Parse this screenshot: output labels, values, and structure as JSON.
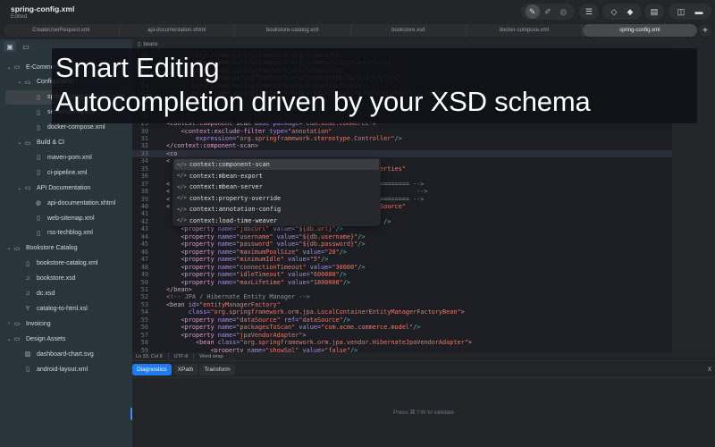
{
  "window": {
    "title": "spring-config.xml",
    "subtitle": "Edited"
  },
  "toolbar": {
    "icons": [
      "pen-icon",
      "signed-pen-icon",
      "globe-icon",
      "format-icon",
      "validate-outline-icon",
      "validate-filled-icon",
      "xsd-doc-icon",
      "sidebar-toggle-icon",
      "bottom-panel-toggle-icon"
    ]
  },
  "tabs": [
    {
      "label": "CreateUserRequest.xml"
    },
    {
      "label": "api-documentation.xhtml"
    },
    {
      "label": "bookstore-catalog.xml"
    },
    {
      "label": "bookstore.xsd"
    },
    {
      "label": "docker-compose.xml"
    },
    {
      "label": "spring-config.xml",
      "active": true
    }
  ],
  "tab_add": "+",
  "sidebar": {
    "items": [
      {
        "label": "E-Commerce",
        "type": "folder",
        "level": 0,
        "chev": "v"
      },
      {
        "label": "Configuration",
        "type": "folder",
        "level": 1,
        "chev": "v"
      },
      {
        "label": "spring-config.xml",
        "type": "file",
        "level": 2,
        "selected": true
      },
      {
        "label": "server-config.xml",
        "type": "file",
        "level": 2
      },
      {
        "label": "docker-compose.xml",
        "type": "file",
        "level": 2
      },
      {
        "label": "Build & CI",
        "type": "folder",
        "level": 1,
        "chev": "v"
      },
      {
        "label": "maven-pom.xml",
        "type": "file",
        "level": 2
      },
      {
        "label": "ci-pipeline.xml",
        "type": "file",
        "level": 2
      },
      {
        "label": "API Documentation",
        "type": "folder",
        "level": 1,
        "chev": "v"
      },
      {
        "label": "api-documentation.xhtml",
        "type": "globe",
        "level": 2
      },
      {
        "label": "web-sitemap.xml",
        "type": "file",
        "level": 2
      },
      {
        "label": "rss-techblog.xml",
        "type": "file",
        "level": 2
      },
      {
        "label": "Bookstore Catalog",
        "type": "folder",
        "level": 0,
        "chev": "v"
      },
      {
        "label": "bookstore-catalog.xml",
        "type": "file",
        "level": 1
      },
      {
        "label": "bookstore.xsd",
        "type": "schema",
        "level": 1
      },
      {
        "label": "dc.xsd",
        "type": "schema",
        "level": 1
      },
      {
        "label": "catalog-to-html.xsl",
        "type": "xsl",
        "level": 1
      },
      {
        "label": "Invoicing",
        "type": "folder",
        "level": 0,
        "chev": ">"
      },
      {
        "label": "Design Assets",
        "type": "folder",
        "level": 0,
        "chev": "v"
      },
      {
        "label": "dashboard-chart.svg",
        "type": "image",
        "level": 1
      },
      {
        "label": "android-layout.xml",
        "type": "file",
        "level": 1
      }
    ]
  },
  "editor": {
    "breadcrumb": "beans",
    "lines": [
      {
        "n": "20",
        "s": [
          [
            "txt",
            "       "
          ],
          [
            "url",
            "http://www.springframework.org/schema/tx"
          ]
        ]
      },
      {
        "n": "21",
        "s": [
          [
            "txt",
            "       "
          ],
          [
            "url",
            "http://www.springframework.org/schema/tx/spring-tx.xsd"
          ]
        ]
      },
      {
        "n": "22",
        "s": [
          [
            "txt",
            "       "
          ],
          [
            "url",
            "http://www.springframework.org/schema/aop"
          ]
        ]
      },
      {
        "n": "23",
        "s": [
          [
            "txt",
            "       "
          ],
          [
            "url",
            "http://www.springframework.org/schema/aop/spring-aop.xsd"
          ]
        ]
      },
      {
        "n": "24",
        "s": [
          [
            "txt",
            "       "
          ],
          [
            "url",
            "http://www.springframework.org/schema/security"
          ]
        ]
      },
      {
        "n": "25",
        "s": [
          [
            "txt",
            "       "
          ],
          [
            "url",
            "http://www.springframework.org/schema/security/spring-security.xsd"
          ],
          [
            "txt",
            "\">"
          ]
        ]
      },
      {
        "n": "26",
        "s": []
      },
      {
        "n": "27",
        "s": []
      },
      {
        "n": "28",
        "s": []
      },
      {
        "n": "29",
        "s": [
          [
            "tag",
            "<context:component-scan "
          ],
          [
            "attr",
            "base-package="
          ],
          [
            "val",
            "\"com.acme.commerce\""
          ],
          [
            "tag",
            ">"
          ]
        ]
      },
      {
        "n": "30",
        "s": [
          [
            "txt",
            "    "
          ],
          [
            "tag",
            "<context:exclude-filter "
          ],
          [
            "attr",
            "type="
          ],
          [
            "val",
            "\"annotation\""
          ]
        ]
      },
      {
        "n": "31",
        "s": [
          [
            "txt",
            "        "
          ],
          [
            "attr",
            "expression="
          ],
          [
            "val",
            "\"org.springframework.stereotype.Controller\""
          ],
          [
            "pun",
            "/>"
          ]
        ]
      },
      {
        "n": "32",
        "s": [
          [
            "tag",
            "</context:component-scan>"
          ]
        ]
      },
      {
        "n": "33",
        "s": [
          [
            "tag",
            "<co"
          ]
        ],
        "current": true
      },
      {
        "n": "34",
        "s": [
          [
            "tag",
            "<"
          ]
        ]
      },
      {
        "n": "35",
        "s": [
          [
            "txt",
            "                                                          "
          ],
          [
            "val",
            "erties\""
          ]
        ]
      },
      {
        "n": "36",
        "s": []
      },
      {
        "n": "37",
        "s": [
          [
            "tag",
            "<"
          ],
          [
            "txt",
            "                                                         "
          ],
          [
            "com",
            "======== -->"
          ]
        ]
      },
      {
        "n": "38",
        "s": [
          [
            "tag",
            "<"
          ],
          [
            "txt",
            "                                                                   "
          ],
          [
            "com",
            "-->"
          ]
        ]
      },
      {
        "n": "39",
        "s": [
          [
            "tag",
            "<"
          ],
          [
            "txt",
            "                                                         "
          ],
          [
            "com",
            "======== -->"
          ]
        ]
      },
      {
        "n": "40",
        "s": [
          [
            "tag",
            "<"
          ],
          [
            "txt",
            "                                                         "
          ],
          [
            "val",
            "Source\""
          ]
        ]
      },
      {
        "n": "41",
        "s": []
      },
      {
        "n": "42",
        "s": [
          [
            "txt",
            "                                                           "
          ],
          [
            "pun",
            "/>"
          ]
        ]
      },
      {
        "n": "43",
        "s": [
          [
            "txt",
            "    "
          ],
          [
            "tag",
            "<property "
          ],
          [
            "attr",
            "name="
          ],
          [
            "val",
            "\"jdbcUrl\" "
          ],
          [
            "attr",
            "value="
          ],
          [
            "val",
            "\"${db.url}\""
          ],
          [
            "pun",
            "/>"
          ]
        ]
      },
      {
        "n": "44",
        "s": [
          [
            "txt",
            "    "
          ],
          [
            "tag",
            "<property "
          ],
          [
            "attr",
            "name="
          ],
          [
            "val",
            "\"username\" "
          ],
          [
            "attr",
            "value="
          ],
          [
            "val",
            "\"${db.username}\""
          ],
          [
            "pun",
            "/>"
          ]
        ]
      },
      {
        "n": "45",
        "s": [
          [
            "txt",
            "    "
          ],
          [
            "tag",
            "<property "
          ],
          [
            "attr",
            "name="
          ],
          [
            "val",
            "\"password\" "
          ],
          [
            "attr",
            "value="
          ],
          [
            "val",
            "\"${db.password}\""
          ],
          [
            "pun",
            "/>"
          ]
        ]
      },
      {
        "n": "46",
        "s": [
          [
            "txt",
            "    "
          ],
          [
            "tag",
            "<property "
          ],
          [
            "attr",
            "name="
          ],
          [
            "val",
            "\"maximumPoolSize\" "
          ],
          [
            "attr",
            "value="
          ],
          [
            "val",
            "\"20\""
          ],
          [
            "pun",
            "/>"
          ]
        ]
      },
      {
        "n": "47",
        "s": [
          [
            "txt",
            "    "
          ],
          [
            "tag",
            "<property "
          ],
          [
            "attr",
            "name="
          ],
          [
            "val",
            "\"minimumIdle\" "
          ],
          [
            "attr",
            "value="
          ],
          [
            "val",
            "\"5\""
          ],
          [
            "pun",
            "/>"
          ]
        ]
      },
      {
        "n": "48",
        "s": [
          [
            "txt",
            "    "
          ],
          [
            "tag",
            "<property "
          ],
          [
            "attr",
            "name="
          ],
          [
            "val",
            "\"connectionTimeout\" "
          ],
          [
            "attr",
            "value="
          ],
          [
            "val",
            "\"30000\""
          ],
          [
            "pun",
            "/>"
          ]
        ]
      },
      {
        "n": "49",
        "s": [
          [
            "txt",
            "    "
          ],
          [
            "tag",
            "<property "
          ],
          [
            "attr",
            "name="
          ],
          [
            "val",
            "\"idleTimeout\" "
          ],
          [
            "attr",
            "value="
          ],
          [
            "val",
            "\"600000\""
          ],
          [
            "pun",
            "/>"
          ]
        ]
      },
      {
        "n": "50",
        "s": [
          [
            "txt",
            "    "
          ],
          [
            "tag",
            "<property "
          ],
          [
            "attr",
            "name="
          ],
          [
            "val",
            "\"maxLifetime\" "
          ],
          [
            "attr",
            "value="
          ],
          [
            "val",
            "\"1800000\""
          ],
          [
            "pun",
            "/>"
          ]
        ]
      },
      {
        "n": "51",
        "s": [
          [
            "tag",
            "</bean>"
          ]
        ]
      },
      {
        "n": "52",
        "s": [
          [
            "com",
            "<!-- JPA / Hibernate Entity Manager -->"
          ]
        ]
      },
      {
        "n": "53",
        "s": [
          [
            "tag",
            "<bean "
          ],
          [
            "attr",
            "id="
          ],
          [
            "val",
            "\"entityManagerFactory\""
          ]
        ]
      },
      {
        "n": "54",
        "s": [
          [
            "txt",
            "      "
          ],
          [
            "attr",
            "class="
          ],
          [
            "val",
            "\"org.springframework.orm.jpa.LocalContainerEntityManagerFactoryBean\""
          ],
          [
            "tag",
            ">"
          ]
        ]
      },
      {
        "n": "55",
        "s": [
          [
            "txt",
            "    "
          ],
          [
            "tag",
            "<property "
          ],
          [
            "attr",
            "name="
          ],
          [
            "val",
            "\"dataSource\" "
          ],
          [
            "attr",
            "ref="
          ],
          [
            "val",
            "\"dataSource\""
          ],
          [
            "pun",
            "/>"
          ]
        ]
      },
      {
        "n": "56",
        "s": [
          [
            "txt",
            "    "
          ],
          [
            "tag",
            "<property "
          ],
          [
            "attr",
            "name="
          ],
          [
            "val",
            "\"packagesToScan\" "
          ],
          [
            "attr",
            "value="
          ],
          [
            "val",
            "\"com.acme.commerce.model\""
          ],
          [
            "pun",
            "/>"
          ]
        ]
      },
      {
        "n": "57",
        "s": [
          [
            "txt",
            "    "
          ],
          [
            "tag",
            "<property "
          ],
          [
            "attr",
            "name="
          ],
          [
            "val",
            "\"jpaVendorAdapter\""
          ],
          [
            "tag",
            ">"
          ]
        ]
      },
      {
        "n": "58",
        "s": [
          [
            "txt",
            "        "
          ],
          [
            "tag",
            "<bean "
          ],
          [
            "attr",
            "class="
          ],
          [
            "val",
            "\"org.springframework.orm.jpa.vendor.HibernateJpaVendorAdapter\""
          ],
          [
            "tag",
            ">"
          ]
        ]
      },
      {
        "n": "59",
        "s": [
          [
            "txt",
            "            "
          ],
          [
            "tag",
            "<property "
          ],
          [
            "attr",
            "name="
          ],
          [
            "val",
            "\"showSql\" "
          ],
          [
            "attr",
            "value="
          ],
          [
            "val",
            "\"false\""
          ],
          [
            "pun",
            "/>"
          ]
        ]
      }
    ],
    "autocomplete": {
      "items": [
        "context:component-scan",
        "context:mbean-export",
        "context:mbean-server",
        "context:property-override",
        "context:annotation-config",
        "context:load-time-weaver"
      ],
      "selected_index": 0,
      "icon": "</>"
    }
  },
  "statusbar": {
    "position": "Ln 33, Col 8",
    "encoding": "UTF-8",
    "wrap": "Word wrap"
  },
  "panel": {
    "tabs": [
      "Diagnostics",
      "XPath",
      "Transform"
    ],
    "active": "Diagnostics",
    "close": "x",
    "hint": "Press ⌘⇧W to validate"
  },
  "banner": {
    "line1": "Smart Editing",
    "line2": "Autocompletion driven by your XSD schema"
  },
  "colors": {
    "accent": "#1e7bf0",
    "sidebar": "#28353b",
    "editor": "#1c1e24"
  }
}
